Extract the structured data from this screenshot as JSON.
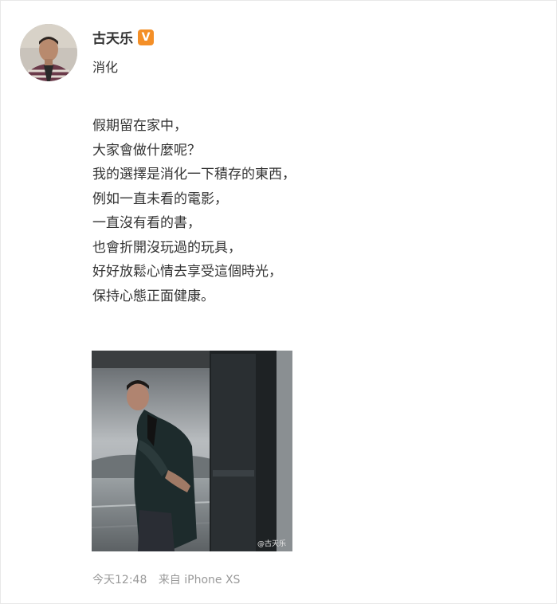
{
  "post": {
    "author": "古天乐",
    "verified_badge": "V",
    "subtitle": "消化",
    "lines": [
      "假期留在家中，",
      "大家會做什麼呢？",
      "我的選擇是消化一下積存的東西，",
      "例如一直未看的電影，",
      "一直沒有看的書，",
      "也會折開沒玩過的玩具，",
      "好好放鬆心情去享受這個時光，",
      "保持心態正面健康。"
    ],
    "image_watermark": "@古天乐",
    "time": "今天12:48",
    "source": "来自 iPhone XS"
  },
  "colors": {
    "verified_badge": "#f48f27",
    "meta_text": "#999999"
  },
  "icons": {
    "badge": "verified-v-icon"
  }
}
